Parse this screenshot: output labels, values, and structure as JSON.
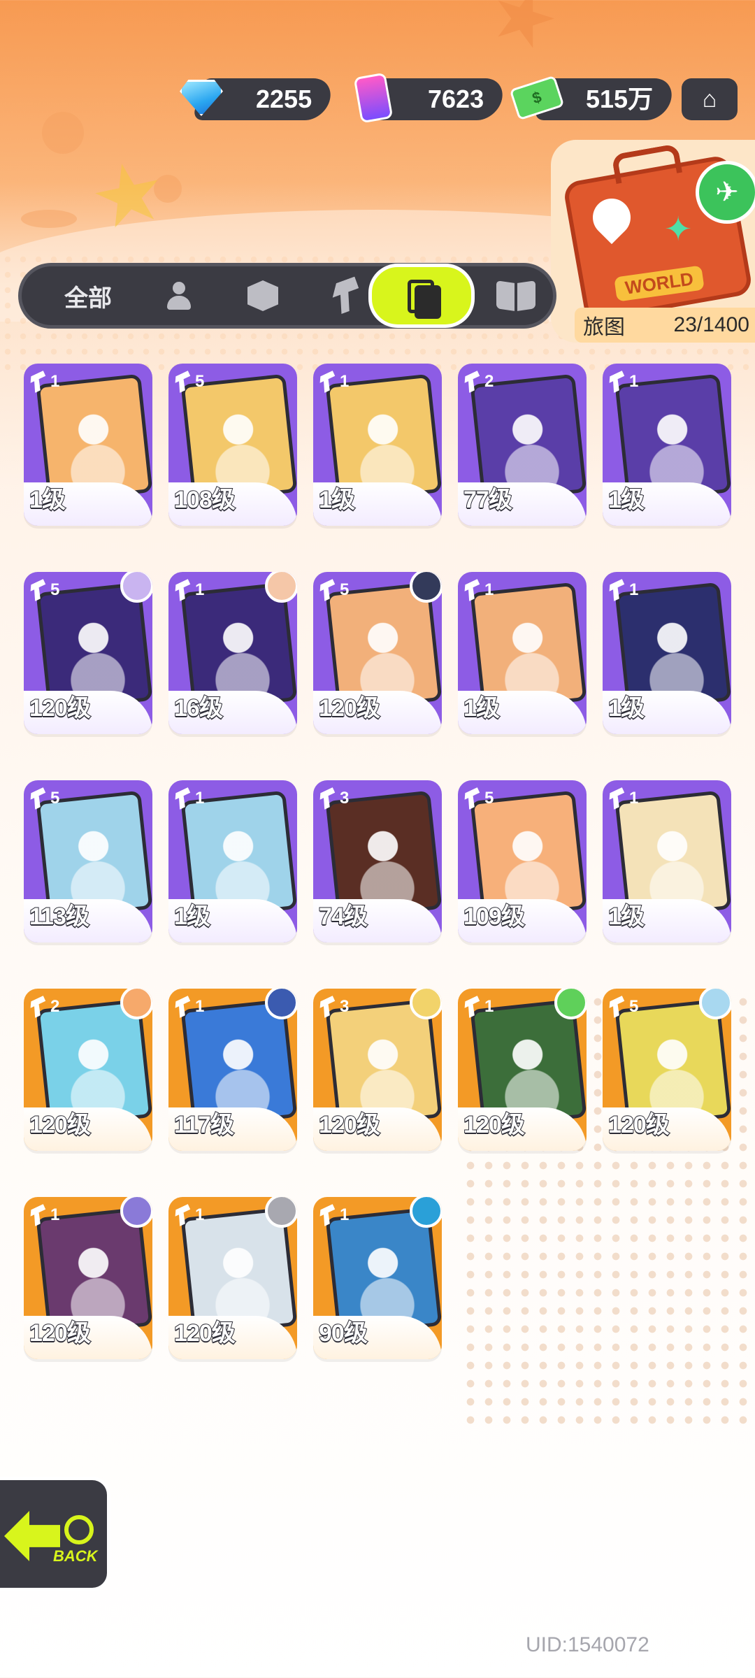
{
  "currency": {
    "gems": "2255",
    "paint": "7623",
    "cash": "515万"
  },
  "map": {
    "badge": "WORLD",
    "label": "旅图",
    "progress": "23/1400"
  },
  "tabs": {
    "all_label": "全部",
    "active": "cards",
    "items": [
      "all",
      "character",
      "box",
      "weapon",
      "cards",
      "book"
    ]
  },
  "cards": [
    {
      "level": "1级",
      "count": "1",
      "color": "purple",
      "art": "#f6b46c"
    },
    {
      "level": "108级",
      "count": "5",
      "color": "purple",
      "art": "#f3c86a"
    },
    {
      "level": "1级",
      "count": "1",
      "color": "purple",
      "art": "#f3c86a"
    },
    {
      "level": "77级",
      "count": "2",
      "color": "purple",
      "art": "#5a3ea8"
    },
    {
      "level": "1级",
      "count": "1",
      "color": "purple",
      "art": "#5a3ea8"
    },
    {
      "level": "120级",
      "count": "5",
      "color": "purple",
      "art": "#3b2a7a",
      "avatar": "#c9b4f0"
    },
    {
      "level": "16级",
      "count": "1",
      "color": "purple",
      "art": "#3b2a7a",
      "avatar": "#f5c7a8"
    },
    {
      "level": "120级",
      "count": "5",
      "color": "purple",
      "art": "#f2b07a",
      "avatar": "#333a5a"
    },
    {
      "level": "1级",
      "count": "1",
      "color": "purple",
      "art": "#f2b07a"
    },
    {
      "level": "1级",
      "count": "1",
      "color": "purple",
      "art": "#2c2f6e"
    },
    {
      "level": "113级",
      "count": "5",
      "color": "purple",
      "art": "#9fd3ea"
    },
    {
      "level": "1级",
      "count": "1",
      "color": "purple",
      "art": "#9fd3ea"
    },
    {
      "level": "74级",
      "count": "3",
      "color": "purple",
      "art": "#5a2e24"
    },
    {
      "level": "109级",
      "count": "5",
      "color": "purple",
      "art": "#f7b07a"
    },
    {
      "level": "1级",
      "count": "1",
      "color": "purple",
      "art": "#f4e2b8"
    },
    {
      "level": "120级",
      "count": "2",
      "color": "orange",
      "art": "#7ad1e8",
      "avatar": "#f6a96b"
    },
    {
      "level": "117级",
      "count": "1",
      "color": "orange",
      "art": "#3a7ad8",
      "avatar": "#3b5bb0"
    },
    {
      "level": "120级",
      "count": "3",
      "color": "orange",
      "art": "#f3d07a",
      "avatar": "#f2d36a"
    },
    {
      "level": "120级",
      "count": "1",
      "color": "orange",
      "art": "#3c6e3a",
      "avatar": "#5fd05a"
    },
    {
      "level": "120级",
      "count": "5",
      "color": "orange",
      "art": "#e8d85a",
      "avatar": "#a8d8f0"
    },
    {
      "level": "120级",
      "count": "1",
      "color": "orange",
      "art": "#6a3a6e",
      "avatar": "#8a7ad8"
    },
    {
      "level": "120级",
      "count": "1",
      "color": "orange",
      "art": "#d8e2ea",
      "avatar": "#a8a8b0"
    },
    {
      "level": "90级",
      "count": "1",
      "color": "orange",
      "art": "#3a86c8",
      "avatar": "#2aa0d8"
    }
  ],
  "back": {
    "label": "BACK"
  },
  "uid": "UID:1540072"
}
